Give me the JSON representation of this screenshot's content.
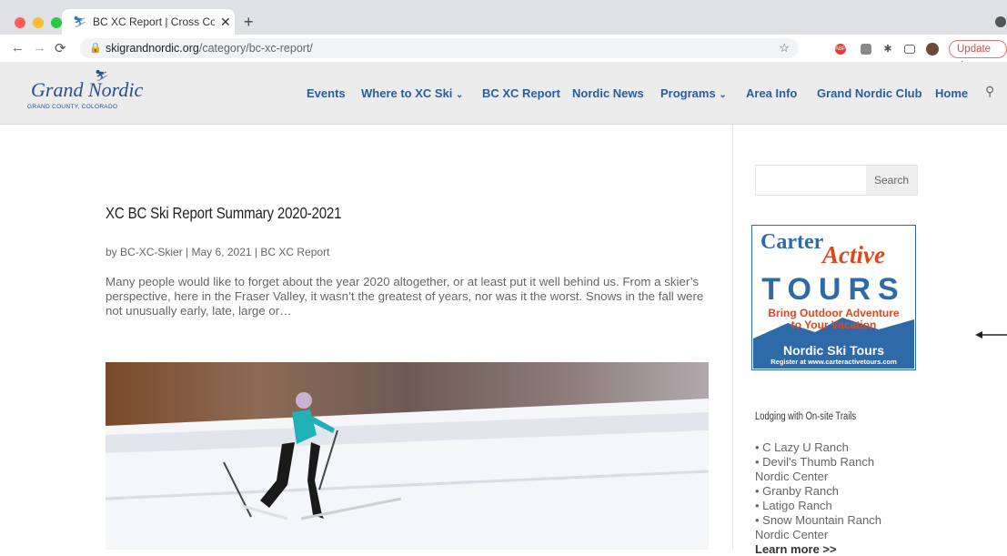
{
  "browser": {
    "tab_title": "BC XC Report | Cross Country",
    "tab_close": "✕",
    "new_tab": "+",
    "url_domain": "skigrandnordic.org",
    "url_path": "/category/bc-xc-report/",
    "update_label": "Update",
    "colors": {
      "red": "#ff5f57",
      "yellow": "#febc2e",
      "green": "#28c840"
    }
  },
  "site": {
    "logo_main": "Grand Nordic",
    "logo_sub": "GRAND COUNTY, COLORADO",
    "nav": [
      {
        "label": "Events"
      },
      {
        "label": "Where to XC Ski",
        "dropdown": true
      },
      {
        "label": "BC XC Report"
      },
      {
        "label": "Nordic News"
      },
      {
        "label": "Programs",
        "dropdown": true
      },
      {
        "label": "Area Info"
      },
      {
        "label": "Grand Nordic Club"
      },
      {
        "label": "Home"
      }
    ],
    "accent_color": "#2a5d9e"
  },
  "post": {
    "title": "XC BC Ski Report Summary 2020-2021",
    "author": "BC-XC-Skier",
    "date": "May 6, 2021",
    "category": "BC XC Report",
    "separator": "|",
    "by": "by",
    "excerpt": "Many people would like to forget about the year 2020 altogether, or at least put it well behind us. From a skier’s perspective, here in the Fraser Valley, it wasn’t the greatest of years, nor was it the worst. Snows in the fall were not unusually early, late, large or…"
  },
  "sidebar": {
    "search_button": "Search",
    "search_placeholder": "",
    "ad": {
      "brand1": "Carter",
      "brand2": "Active",
      "tours": "TOURS",
      "tagline1": "Bring Outdoor Adventure",
      "tagline2": "to Your Vacation",
      "product": "Nordic Ski Tours",
      "register": "Register at www.carteractivetours.com"
    },
    "lodging_heading": "Lodging with On-site Trails",
    "lodging": [
      "• C Lazy U Ranch",
      "• Devil's Thumb Ranch Nordic Center",
      "• Granby Ranch",
      "• Latigo Ranch",
      "• Snow Mountain Ranch Nordic Center"
    ],
    "learn_more": "Learn more >>"
  }
}
